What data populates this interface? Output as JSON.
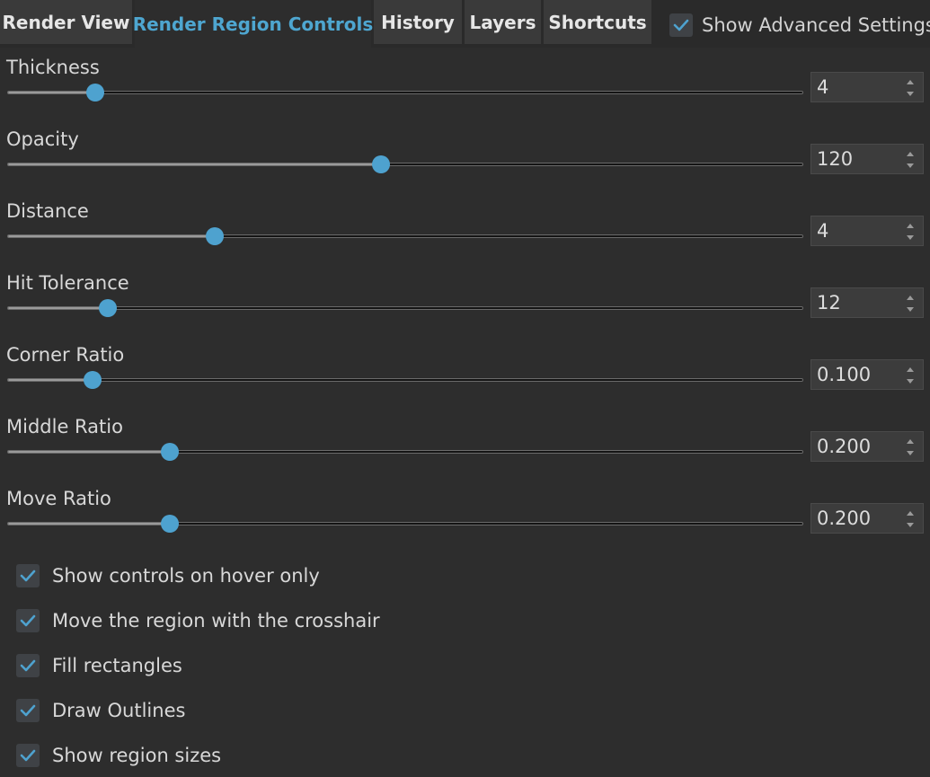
{
  "tabs": [
    {
      "label": "Render View"
    },
    {
      "label": "Render Region Controls",
      "active": true
    },
    {
      "label": "History"
    },
    {
      "label": "Layers"
    },
    {
      "label": "Shortcuts"
    }
  ],
  "advanced": {
    "label": "Show Advanced Settings",
    "checked": true
  },
  "sliders": [
    {
      "label": "Thickness",
      "value": "4",
      "fraction": 0.11
    },
    {
      "label": "Opacity",
      "value": "120",
      "fraction": 0.47
    },
    {
      "label": "Distance",
      "value": "4",
      "fraction": 0.26
    },
    {
      "label": "Hit Tolerance",
      "value": "12",
      "fraction": 0.126
    },
    {
      "label": "Corner Ratio",
      "value": "0.100",
      "fraction": 0.106
    },
    {
      "label": "Middle Ratio",
      "value": "0.200",
      "fraction": 0.204
    },
    {
      "label": "Move Ratio",
      "value": "0.200",
      "fraction": 0.204
    }
  ],
  "options": [
    {
      "label": "Show controls on hover only",
      "checked": true
    },
    {
      "label": "Move the region with the crosshair",
      "checked": true
    },
    {
      "label": "Fill rectangles",
      "checked": true
    },
    {
      "label": "Draw Outlines",
      "checked": true
    },
    {
      "label": "Show region sizes",
      "checked": true
    }
  ],
  "colors": {
    "accent": "#4ea2cf",
    "background": "#2d2d2d",
    "tab": "#3a3a3a",
    "active_tab_text": "#4ea6d0"
  }
}
